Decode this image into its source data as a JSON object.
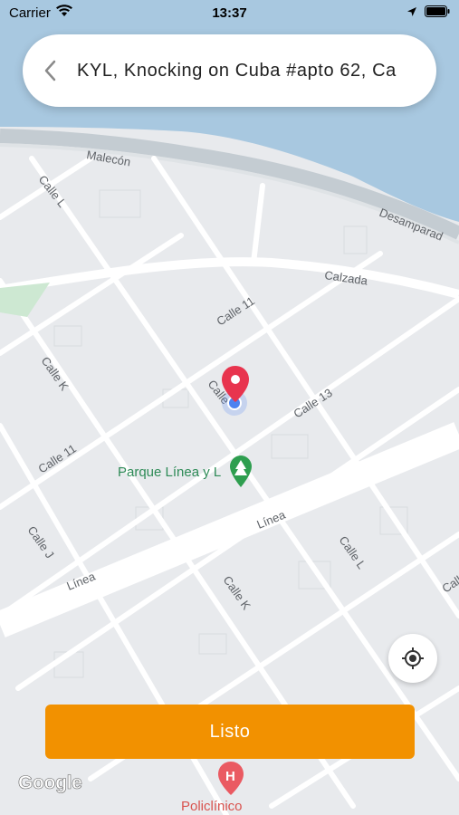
{
  "status_bar": {
    "carrier": "Carrier",
    "time": "13:37"
  },
  "search": {
    "address": "KYL, Knocking on Cuba #apto 62, Ca"
  },
  "map": {
    "streets": {
      "malecon": "Malecón",
      "desamparados": "Desamparad",
      "calle_l_top": "Calle L",
      "calzada": "Calzada",
      "calle_11_top": "Calle 11",
      "calle_k_left": "Calle K",
      "calle_center": "Calle",
      "calle_13": "Calle 13",
      "calle_11_left": "Calle 11",
      "calle_j": "Calle J",
      "linea_center": "Línea",
      "linea_left": "Línea",
      "calle_l_right": "Calle L",
      "calle_k_bottom": "Calle K",
      "calle_edge": "Calle"
    },
    "poi": {
      "park": "Parque Línea y L",
      "clinic": "Policlínico"
    }
  },
  "locate_button": {
    "icon": "crosshair-icon"
  },
  "confirm_button": {
    "label": "Listo"
  },
  "attribution": {
    "logo": "Google"
  },
  "colors": {
    "accent": "#f29100",
    "pin": "#e8344e",
    "water": "#a8c8e0",
    "park_icon": "#2e9e4f"
  }
}
